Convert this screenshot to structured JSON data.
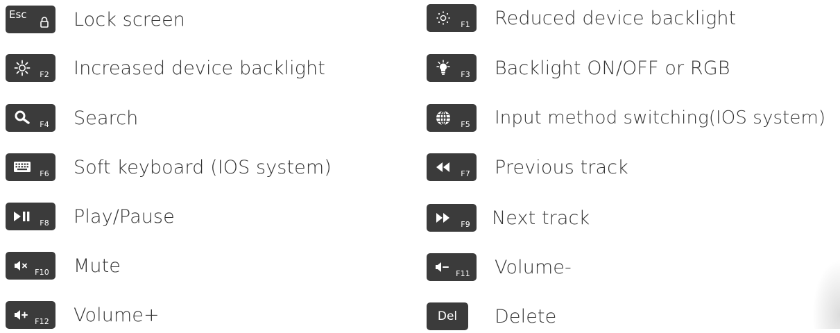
{
  "colors": {
    "key_bg": "#3b3b3b",
    "key_text": "#ffffff",
    "label_text": "#333333",
    "background": "#ffffff"
  },
  "left": [
    {
      "fn": "Esc",
      "lock": "lock-icon",
      "label": "Lock screen",
      "icon": "lock-icon"
    },
    {
      "fn": "F2",
      "label": "Increased device backlight",
      "icon": "sun-bright-icon"
    },
    {
      "fn": "F4",
      "label": "Search",
      "icon": "search-icon"
    },
    {
      "fn": "F6",
      "label": "Soft keyboard (IOS system)",
      "icon": "keyboard-icon"
    },
    {
      "fn": "F8",
      "label": "Play/Pause",
      "icon": "play-pause-icon"
    },
    {
      "fn": "F10",
      "label": "Mute",
      "icon": "mute-icon"
    },
    {
      "fn": "F12",
      "label": "Volume+",
      "icon": "volume-up-icon"
    }
  ],
  "right": [
    {
      "fn": "F1",
      "label": "Reduced device backlight",
      "icon": "sun-dim-icon"
    },
    {
      "fn": "F3",
      "label": "Backlight ON/OFF or RGB",
      "icon": "bulb-icon"
    },
    {
      "fn": "F5",
      "label": "Input method switching(IOS system)",
      "icon": "globe-icon"
    },
    {
      "fn": "F7",
      "label": "Previous track",
      "icon": "rewind-icon"
    },
    {
      "fn": "F9",
      "label": "Next track",
      "icon": "fast-forward-icon"
    },
    {
      "fn": "F11",
      "label": "Volume-",
      "icon": "volume-down-icon"
    },
    {
      "fn": "Del",
      "label": "Delete",
      "icon": "delete-key"
    }
  ]
}
